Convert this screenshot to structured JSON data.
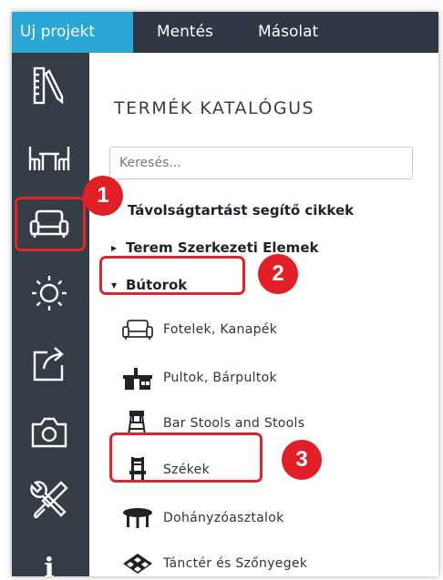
{
  "topbar": {
    "tabs": [
      {
        "label": "Uj projekt",
        "active": true
      },
      {
        "label": "Mentés",
        "active": false
      },
      {
        "label": "Másolat",
        "active": false
      }
    ]
  },
  "sidebar": {
    "items": [
      {
        "icon": "ruler-pencil-icon"
      },
      {
        "icon": "table-chairs-icon"
      },
      {
        "icon": "sofa-icon",
        "highlighted": true
      },
      {
        "icon": "sun-icon"
      },
      {
        "icon": "export-icon"
      },
      {
        "icon": "camera-icon"
      },
      {
        "icon": "tools-icon"
      },
      {
        "icon": "info-icon",
        "glyph": "i"
      }
    ]
  },
  "catalog": {
    "title": "TERMÉK KATALÓGUS",
    "search_placeholder": "Keresés...",
    "categories": [
      {
        "label": "Távolságtartást segítő cikkek"
      },
      {
        "label": "Terem Szerkezeti Elemek"
      },
      {
        "label": "Bútorok",
        "expanded": true
      }
    ],
    "subcategories": [
      {
        "label": "Fotelek, Kanapék",
        "icon": "sofa-icon"
      },
      {
        "label": "Pultok, Bárpultok",
        "icon": "bar-counter-icon"
      },
      {
        "label": "Bar Stools and Stools",
        "icon": "bar-stool-icon"
      },
      {
        "label": "Székek",
        "icon": "chair-icon"
      },
      {
        "label": "Dohányzóasztalok",
        "icon": "coffee-table-icon"
      },
      {
        "label": "Tánctér és Szőnyegek",
        "icon": "dance-floor-icon"
      }
    ]
  },
  "annotations": {
    "badges": [
      "1",
      "2",
      "3"
    ],
    "highlight_color": "#e0242b"
  },
  "colors": {
    "topbar": "#2f3744",
    "active_tab": "#2aa7d4",
    "sidebar": "#343c46"
  }
}
